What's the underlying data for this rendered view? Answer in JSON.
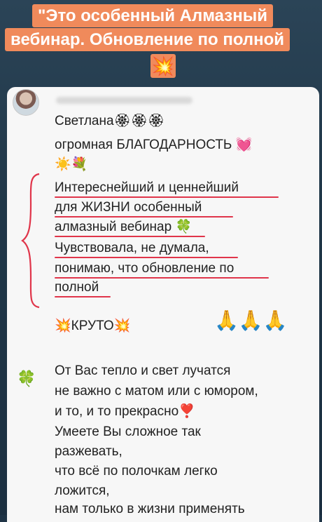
{
  "banner": {
    "line1": "\"Это особенный Алмазный",
    "line2": "вебинар. Обновление по полной",
    "icon": "💥"
  },
  "message1": {
    "sender": "Светлана",
    "sender_emoji": "🏵🏵🏵",
    "line2": "огромная БЛАГОДАРНОСТЬ",
    "line2_emoji": "💓",
    "line3_emoji": "☀️💐",
    "quote_lines": [
      "Интереснейший и ценнейший",
      "для ЖИЗНИ особенный",
      "алмазный  вебинар",
      "Чувствовала, не думала,",
      "понимаю, что обновление по",
      "полной"
    ],
    "quote_line3_emoji": "🍀",
    "kruto": "КРУТО",
    "kruto_emoji": "💥",
    "hands": "🙏🙏🙏"
  },
  "message2": {
    "side_emoji": "🍀",
    "lines": [
      "От Вас тепло и свет лучатся",
      "не важно с матом или с юмором,",
      "и то, и то прекрасно",
      "Умеете Вы сложное так",
      "разжевать,",
      " что всё по полочкам легко",
      "ложится,",
      "нам только в жизни применять"
    ],
    "line3_emoji": "❣️"
  },
  "colors": {
    "banner": "#f08a5b",
    "underline": "#e0354a",
    "card": "#f7f7f7"
  }
}
